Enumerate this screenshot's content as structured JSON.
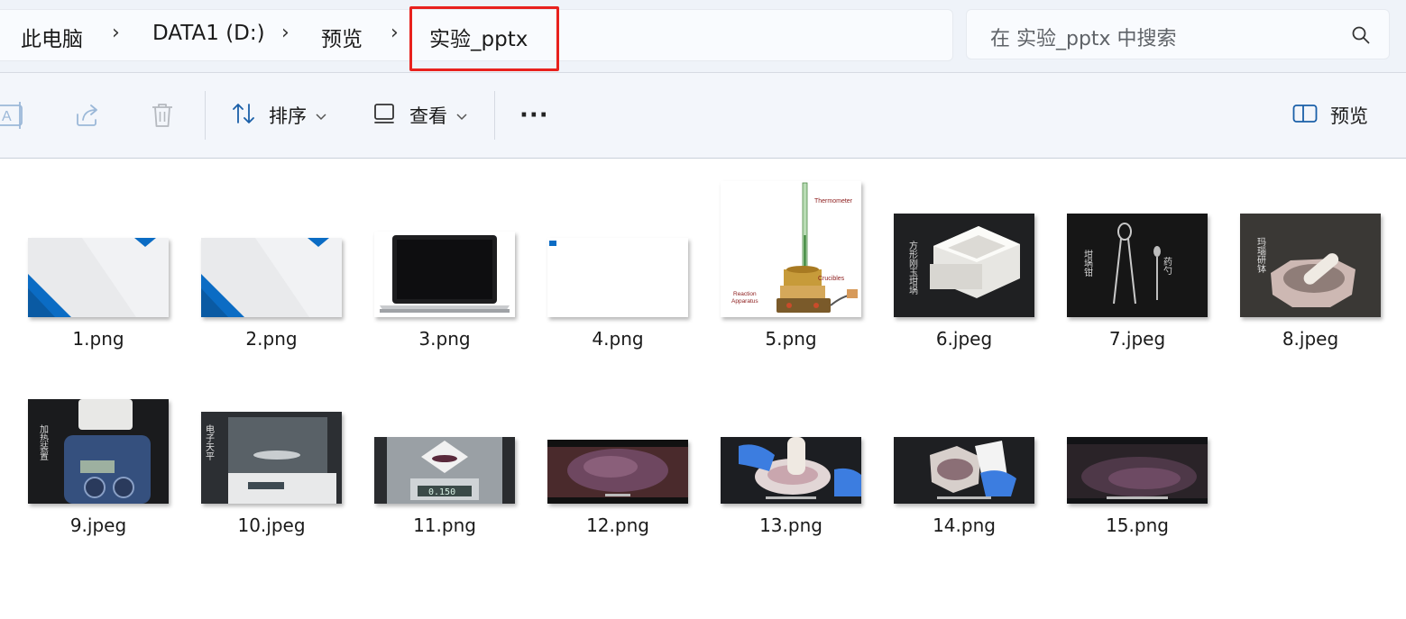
{
  "breadcrumb": {
    "items": [
      "此电脑",
      "DATA1 (D:)",
      "预览",
      "实验_pptx"
    ],
    "separator": "›"
  },
  "search": {
    "placeholder": "在 实验_pptx 中搜索",
    "icon": "search-icon"
  },
  "toolbar": {
    "rename_icon": "rename-icon",
    "share_icon": "share-icon",
    "delete_icon": "delete-icon",
    "sort_label": "排序",
    "view_label": "查看",
    "more_label": "···",
    "preview_label": "预览"
  },
  "files": [
    {
      "name": "1.png"
    },
    {
      "name": "2.png"
    },
    {
      "name": "3.png"
    },
    {
      "name": "4.png"
    },
    {
      "name": "5.png"
    },
    {
      "name": "6.jpeg"
    },
    {
      "name": "7.jpeg"
    },
    {
      "name": "8.jpeg"
    },
    {
      "name": "9.jpeg"
    },
    {
      "name": "10.jpeg"
    },
    {
      "name": "11.png"
    },
    {
      "name": "12.png"
    },
    {
      "name": "13.png"
    },
    {
      "name": "14.png"
    },
    {
      "name": "15.png"
    }
  ],
  "thumb_text": {
    "t5_thermometer": "Thermometer",
    "t5_crucibles": "Crucibles",
    "t5_reaction": "Reaction",
    "t5_apparatus": "Apparatus",
    "t6_label": "方形刚玉坩埚",
    "t7_label1": "坩埚钳",
    "t7_label2": "药勺",
    "t8_label": "玛瑙研钵",
    "t9_label": "加热装置",
    "t10_label": "电子天平",
    "t11_readout": "0.150"
  },
  "colors": {
    "accent_blue": "#0b6cc4",
    "highlight_red": "#e8211d",
    "topbar_bg": "#eff3f9",
    "cmdbar_bg": "#f3f6fb"
  }
}
